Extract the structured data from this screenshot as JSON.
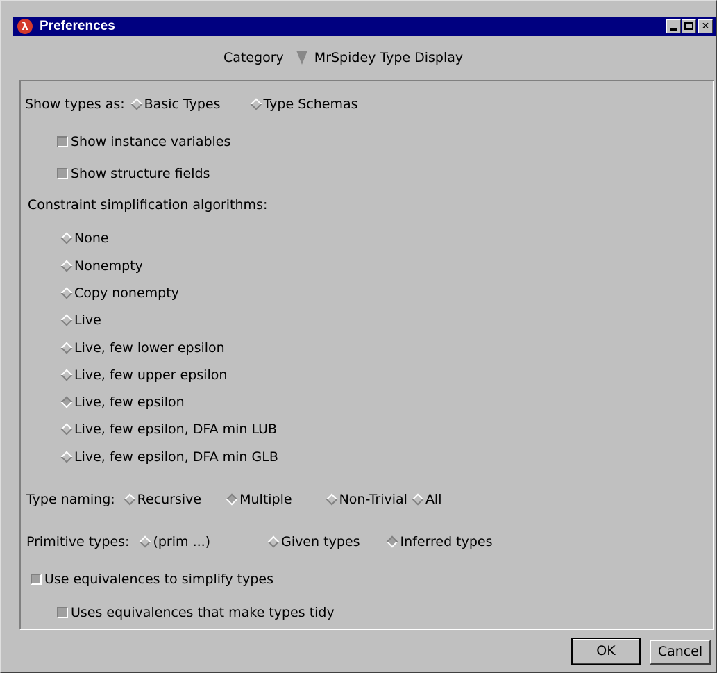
{
  "window": {
    "title": "Preferences",
    "icon": "lambda-icon",
    "controls": [
      "minimize-icon",
      "maximize-icon",
      "close-icon"
    ]
  },
  "category": {
    "label": "Category",
    "selected": "MrSpidey Type Display"
  },
  "show_types": {
    "label": "Show types as:",
    "options": [
      "Basic Types",
      "Type Schemas"
    ],
    "selected": null
  },
  "checkboxes_top": [
    {
      "label": "Show instance variables",
      "checked": false
    },
    {
      "label": "Show structure fields",
      "checked": false
    }
  ],
  "constraint": {
    "label": "Constraint simplification algorithms:",
    "options": [
      "None",
      "Nonempty",
      "Copy nonempty",
      "Live",
      "Live, few lower epsilon",
      "Live, few upper epsilon",
      "Live, few epsilon",
      "Live, few epsilon, DFA min LUB",
      "Live, few epsilon, DFA min GLB"
    ],
    "selected": "Live, few epsilon"
  },
  "type_naming": {
    "label": "Type naming:",
    "options": [
      "Recursive",
      "Multiple",
      "Non-Trivial",
      "All"
    ],
    "selected": "Multiple"
  },
  "primitive_types": {
    "label": "Primitive types:",
    "options": [
      "(prim ...)",
      "Given types",
      "Inferred types"
    ],
    "selected": "Inferred types"
  },
  "equivalences": [
    {
      "label": "Use equivalences to simplify types",
      "checked": false
    },
    {
      "label": "Uses equivalences that make types tidy",
      "checked": false
    }
  ],
  "buttons": {
    "ok": "OK",
    "cancel": "Cancel"
  }
}
